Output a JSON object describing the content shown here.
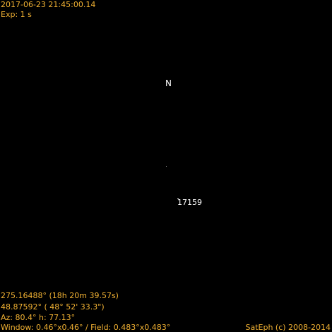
{
  "header": {
    "timestamp": "2017-06-23 21:45:00.14",
    "exposure": "Exp: 1 s"
  },
  "sky": {
    "north_label": "N",
    "satellite_id": "17159"
  },
  "footer": {
    "ra": "275.16488° (18h 20m 39.57s)",
    "dec": "48.87592° ( 48° 52' 33.3\")",
    "azalt": "Az: 80.4° h: 77.13°",
    "fov": "Window: 0.46°x0.46°  / Field: 0.483°x0.483°",
    "copyright": "SatEph (c) 2008-2014"
  },
  "colors": {
    "background": "#000000",
    "hud_text": "#f2b233",
    "label_text": "#ffffff"
  }
}
